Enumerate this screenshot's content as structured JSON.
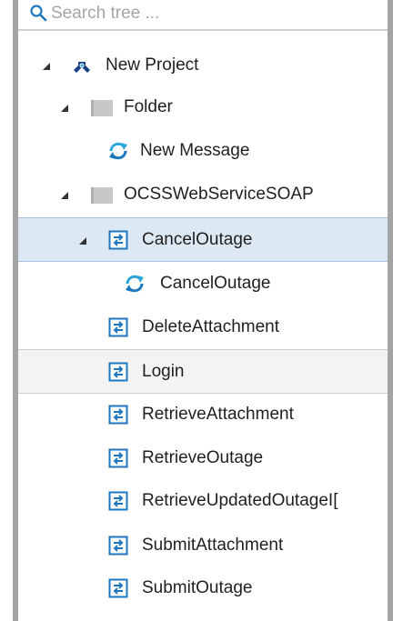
{
  "search": {
    "placeholder": "Search tree ..."
  },
  "tree": {
    "root": {
      "label": "New Project"
    },
    "folder": {
      "label": "Folder"
    },
    "new_message": {
      "label": "New Message"
    },
    "service": {
      "label": "OCSSWebServiceSOAP"
    },
    "ops": [
      {
        "label": "CancelOutage"
      },
      {
        "label": "CancelOutage"
      },
      {
        "label": "DeleteAttachment"
      },
      {
        "label": "Login"
      },
      {
        "label": "RetrieveAttachment"
      },
      {
        "label": "RetrieveOutage"
      },
      {
        "label": "RetrieveUpdatedOutageI["
      },
      {
        "label": "SubmitAttachment"
      },
      {
        "label": "SubmitOutage"
      }
    ]
  },
  "colors": {
    "refresh_blue": "#2aa6d8",
    "op_icon_blue": "#1d77bf",
    "project_icon": "#1b3f87",
    "selected_bg": "#dde8f5"
  }
}
